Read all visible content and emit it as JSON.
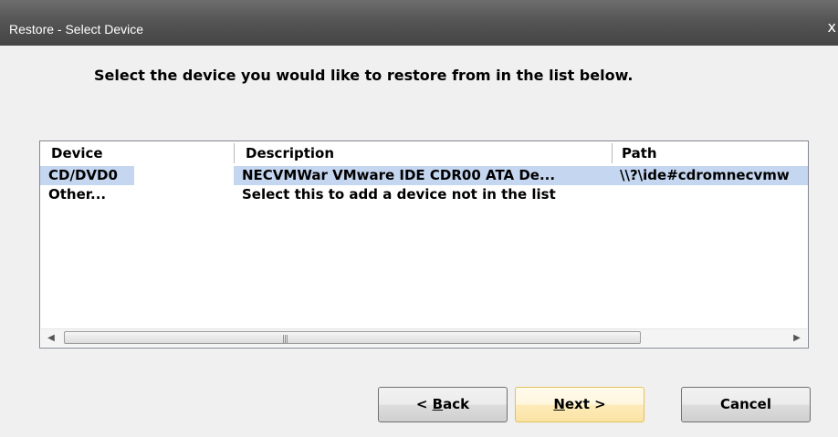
{
  "window": {
    "title": "Restore - Select Device",
    "close_glyph": "x"
  },
  "instruction": "Select the device you would like to restore from in the list below.",
  "list": {
    "columns": [
      "Device",
      "Description",
      "Path"
    ],
    "rows": [
      {
        "device": "CD/DVD0",
        "description": "NECVMWar VMware IDE CDR00 ATA De...",
        "path": "\\\\?\\ide#cdromnecvmw",
        "selected": true
      },
      {
        "device": "Other...",
        "description": "Select this to add a device not in the list",
        "path": "",
        "selected": false
      }
    ],
    "scrollbar": {
      "left_arrow": "◀",
      "right_arrow": "▶",
      "grip": "|||"
    }
  },
  "buttons": {
    "back": {
      "prefix": "< ",
      "mnemonic": "B",
      "rest": "ack"
    },
    "next": {
      "mnemonic": "N",
      "rest": "ext >"
    },
    "cancel": "Cancel"
  },
  "colors": {
    "selection": "#c5d6f0",
    "titlebar": "#555555",
    "default_button_border": "#e2c35a"
  }
}
